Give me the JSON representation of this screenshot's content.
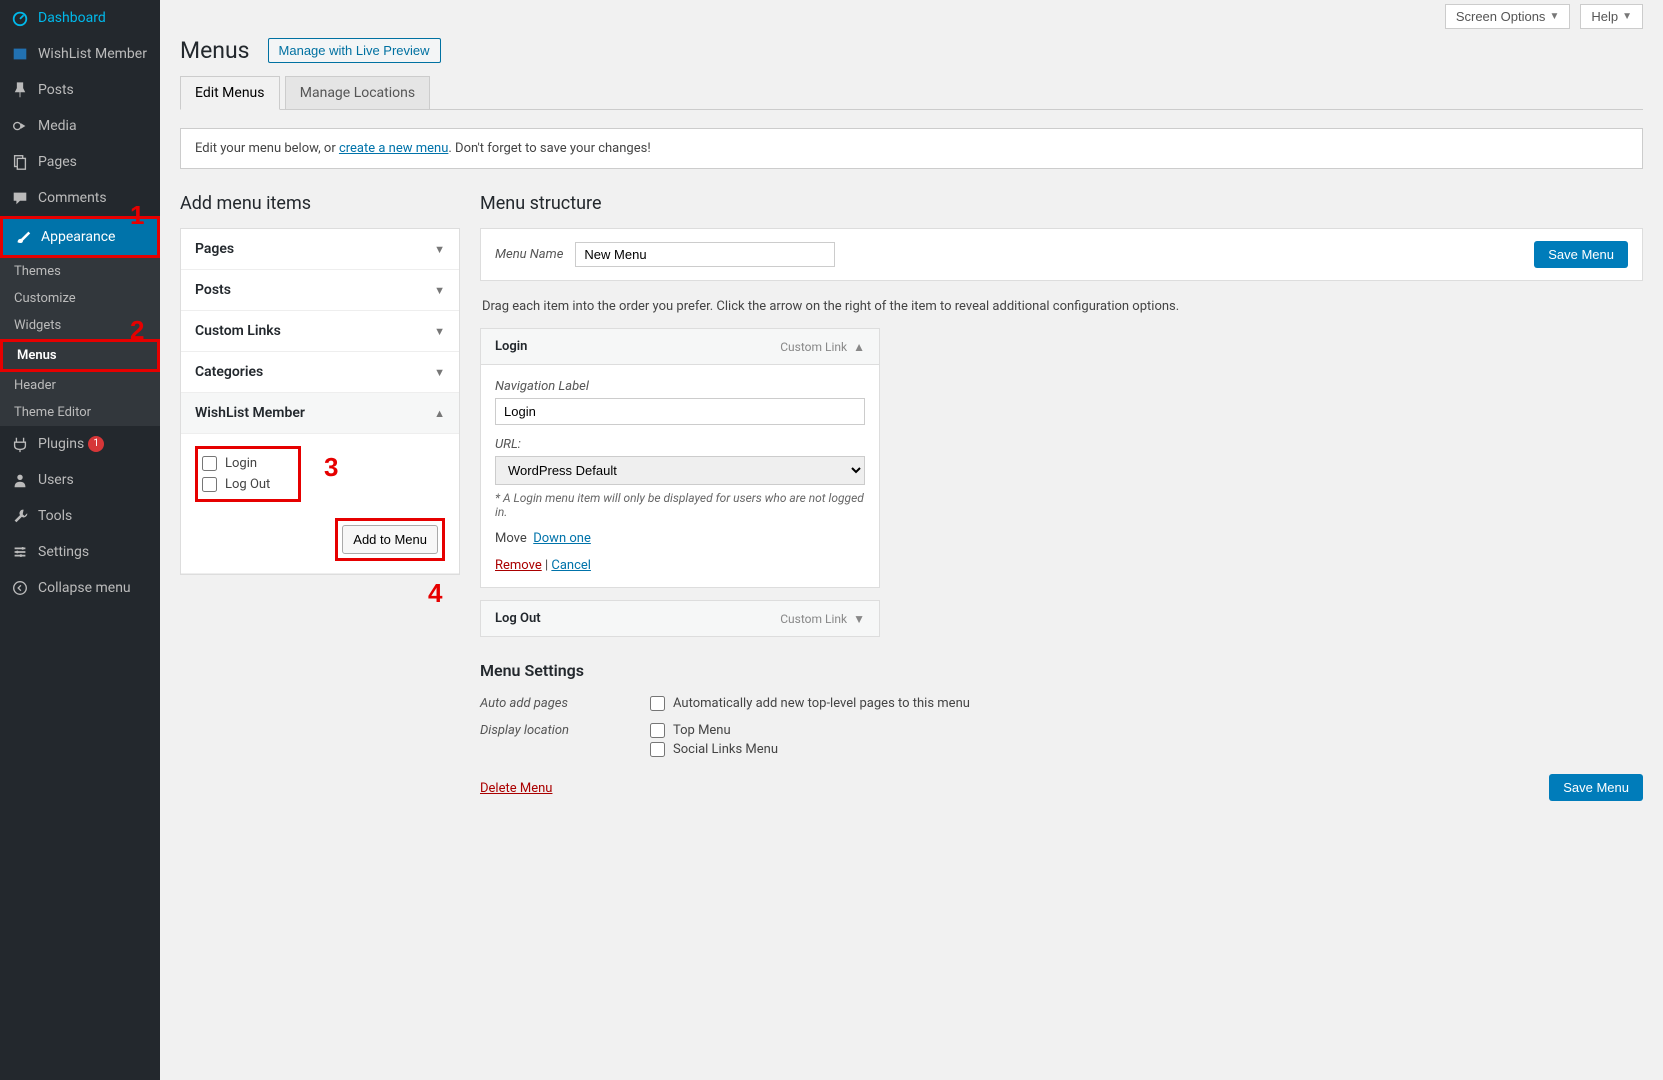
{
  "top": {
    "screen_options": "Screen Options",
    "help": "Help"
  },
  "sidebar": {
    "items": [
      {
        "icon": "dashboard",
        "label": "Dashboard"
      },
      {
        "icon": "wishlist",
        "label": "WishList Member"
      },
      {
        "icon": "pin",
        "label": "Posts"
      },
      {
        "icon": "media",
        "label": "Media"
      },
      {
        "icon": "page",
        "label": "Pages"
      },
      {
        "icon": "comment",
        "label": "Comments"
      },
      {
        "icon": "brush",
        "label": "Appearance"
      },
      {
        "icon": "plugin",
        "label": "Plugins"
      },
      {
        "icon": "user",
        "label": "Users"
      },
      {
        "icon": "wrench",
        "label": "Tools"
      },
      {
        "icon": "settings",
        "label": "Settings"
      },
      {
        "icon": "collapse",
        "label": "Collapse menu"
      }
    ],
    "plugins_badge": "1",
    "appearance_sub": [
      "Themes",
      "Customize",
      "Widgets",
      "Menus",
      "Header",
      "Theme Editor"
    ]
  },
  "page": {
    "title": "Menus",
    "title_button": "Manage with Live Preview",
    "tabs": [
      "Edit Menus",
      "Manage Locations"
    ],
    "notice_pre": "Edit your menu below, or ",
    "notice_link": "create a new menu",
    "notice_post": ". Don't forget to save your changes!"
  },
  "left": {
    "heading": "Add menu items",
    "panels": [
      {
        "label": "Pages"
      },
      {
        "label": "Posts"
      },
      {
        "label": "Custom Links"
      },
      {
        "label": "Categories"
      },
      {
        "label": "WishList Member"
      }
    ],
    "wlm_options": [
      "Login",
      "Log Out"
    ],
    "add_btn": "Add to Menu"
  },
  "right": {
    "heading": "Menu structure",
    "menu_name_label": "Menu Name",
    "menu_name_value": "New Menu",
    "save_btn": "Save Menu",
    "instruction": "Drag each item into the order you prefer. Click the arrow on the right of the item to reveal additional configuration options.",
    "items": [
      {
        "title": "Login",
        "type": "Custom Link",
        "expanded": true,
        "nav_label": "Navigation Label",
        "nav_value": "Login",
        "url_label": "URL:",
        "url_value": "WordPress Default",
        "note": "* A Login menu item will only be displayed for users who are not logged in.",
        "move_label": "Move",
        "move_link": "Down one",
        "remove": "Remove",
        "cancel": "Cancel"
      },
      {
        "title": "Log Out",
        "type": "Custom Link",
        "expanded": false
      }
    ],
    "settings_heading": "Menu Settings",
    "auto_label": "Auto add pages",
    "auto_opt": "Automatically add new top-level pages to this menu",
    "display_label": "Display location",
    "display_opts": [
      "Top Menu",
      "Social Links Menu"
    ],
    "delete": "Delete Menu"
  },
  "annotations": {
    "n1": "1",
    "n2": "2",
    "n3": "3",
    "n4": "4"
  }
}
